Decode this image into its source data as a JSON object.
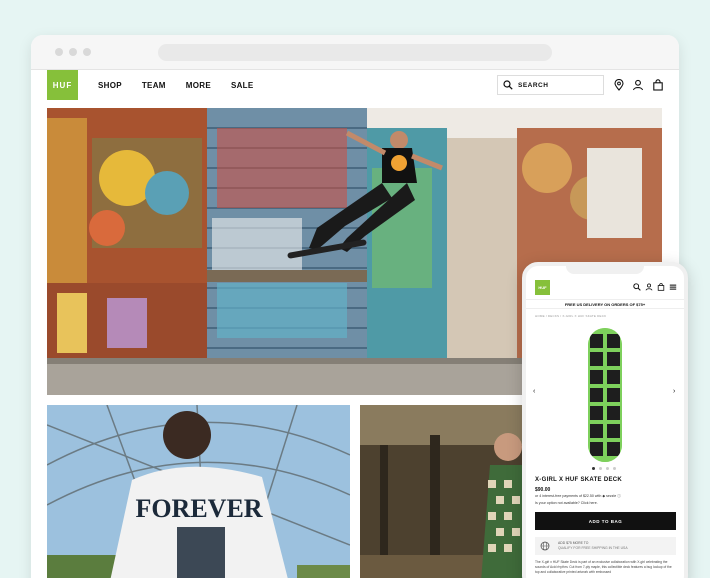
{
  "header": {
    "logo": "HUF",
    "nav": [
      "SHOP",
      "TEAM",
      "MORE",
      "SALE"
    ],
    "search_label": "SEARCH"
  },
  "hero": {
    "image": "skateboarder grinding a ledge in front of graffiti-covered roller shutters"
  },
  "tiles": {
    "left_shirt_text": "FOREVER"
  },
  "phone": {
    "logo": "HUF",
    "shipping_banner": "FREE US DELIVERY ON ORDERS OF $75+",
    "breadcrumb": "HOME / DECKS / X-GIRL X HUF SKATE DECK",
    "product_title": "X-GIRL X HUF SKATE DECK",
    "price": "$90.00",
    "payments": "or 4 interest-free payments of $22.50 with ◆ sezzle ⓘ",
    "availability": "Is your option not available? Click here.",
    "add_to_bag": "ADD TO BAG",
    "info_title": "ADD $75 MORE TO",
    "info_sub": "QUALIFY FOR FREE SHIPPING IN THE USA",
    "description": "The X-girl x HUF Skate Deck is part of an exclusive collaboration with X-girl celebrating the sounds of Acid rhythm. Cut from 7-ply maple, this collectible deck features a bug lockup of the top and collaborative printed artwork with embossed"
  },
  "colors": {
    "brand_green": "#86c03a",
    "background": "#e6f5f3",
    "button": "#111111"
  }
}
